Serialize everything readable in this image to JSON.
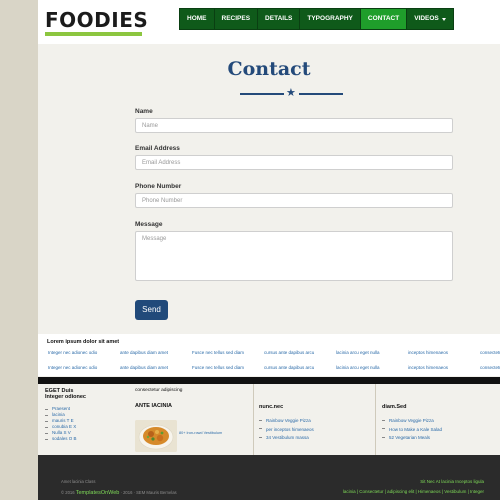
{
  "logo": "FOODIES",
  "nav": [
    {
      "label": "HOME",
      "active": false
    },
    {
      "label": "RECIPES",
      "active": false
    },
    {
      "label": "DETAILS",
      "active": false
    },
    {
      "label": "TYPOGRAPHY",
      "active": false
    },
    {
      "label": "CONTACT",
      "active": true
    },
    {
      "label": "VIDEOS",
      "active": false,
      "dropdown": true
    }
  ],
  "contact": {
    "title": "Contact",
    "fields": [
      {
        "label": "Name",
        "placeholder": "Name"
      },
      {
        "label": "Email Address",
        "placeholder": "Email Address"
      },
      {
        "label": "Phone Number",
        "placeholder": "Phone Number"
      },
      {
        "label": "Message",
        "placeholder": "Message"
      }
    ],
    "send_label": "Send"
  },
  "strip": {
    "title": "Lorem ipsum dolor sit amet",
    "row1": [
      "Integer nec adionec odio",
      "ante dapibus diam amet",
      "Fusce nec tellus sed diam",
      "cursus ante dapibus arcu",
      "lacinia arcu eget nulla",
      "inceptos himenaeos",
      "consectetur"
    ],
    "row2": [
      "Integer nec adionec odio",
      "ante dapibus diam amet",
      "Fusce nec tellus sed diam",
      "cursus ante dapibus arcu",
      "lacinia arcu eget nulla",
      "inceptos himenaeos",
      "consectetur"
    ]
  },
  "footer": {
    "col1": {
      "title1": "EGET Duis",
      "title2": "Integer odionec",
      "items": [
        "Praesent",
        "lacinia",
        "mauris T E",
        "conubia E X",
        "Nulla S V",
        "sodales O B"
      ]
    },
    "col2": {
      "subtitle": "consectetur adipiscing",
      "title": "ANTE IACINIA",
      "caption": "80+ Iron-rowd Vestibulum"
    },
    "col3": {
      "title": "nunc.nec",
      "items": [
        "Rainbow Veggie Pizza",
        "per inceptos himenaeos",
        "34 Vestibulum massa"
      ]
    },
    "col4": {
      "title": "diam.Sed",
      "items": [
        "Rainbow Veggie Pizza",
        "How to Make a Kale Salad",
        "52 Vegetarian Meals"
      ]
    }
  },
  "bottom": {
    "left1": "Amet lacinia Class",
    "left2_prefix": "© 2016",
    "left2_link": "TemplatesOnWeb",
    "left2_suffix": "· 2016 · SEM Mauris Bernelas",
    "right1": "Sit Nec At lacinia Inceptos ligula",
    "right2": "lacinia | Consectetur | adipiscing elit | Himenaeos | Vestibulum | Integer"
  },
  "colors": {
    "nav_bg": "#0f5a1a",
    "nav_active": "#1f9e2b",
    "logo_underline": "#8cc63f",
    "title": "#244a7a",
    "send_button": "#214a7a",
    "link": "#2a6aa8",
    "footer_green": "#7ed957"
  }
}
